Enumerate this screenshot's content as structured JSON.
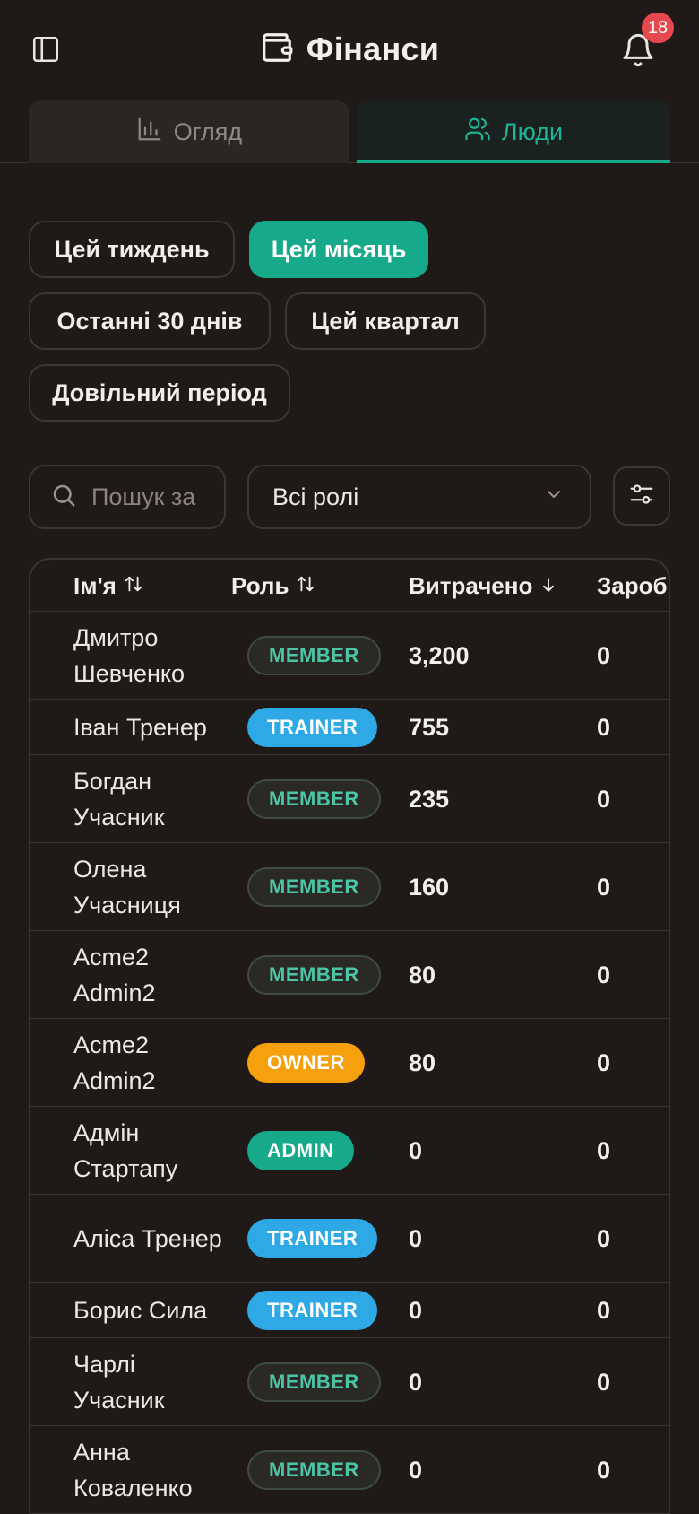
{
  "header": {
    "title": "Фінанси",
    "notification_count": "18",
    "wallet_icon": "wallet-icon",
    "bell_icon": "bell-icon"
  },
  "tabs": [
    {
      "label": "Огляд",
      "icon": "bar-chart-icon",
      "active": false
    },
    {
      "label": "Люди",
      "icon": "users-icon",
      "active": true
    }
  ],
  "periods": [
    {
      "label": "Цей тиждень",
      "active": false
    },
    {
      "label": "Цей місяць",
      "active": true
    },
    {
      "label": "Останні 30 днів",
      "active": false
    },
    {
      "label": "Цей квартал",
      "active": false
    },
    {
      "label": "Довільний період",
      "active": false
    }
  ],
  "search": {
    "placeholder": "Пошук за",
    "value": ""
  },
  "role_filter": {
    "selected": "Всі ролі"
  },
  "table": {
    "columns": [
      {
        "label": "Ім'я",
        "sort": "both"
      },
      {
        "label": "Роль",
        "sort": "both"
      },
      {
        "label": "Витрачено",
        "sort": "desc"
      },
      {
        "label": "Зароб",
        "sort": "none"
      }
    ],
    "rows": [
      {
        "name": "Дмитро Шевченко",
        "role": "MEMBER",
        "spent": "3,200",
        "earned": "0"
      },
      {
        "name": "Іван Тренер",
        "role": "TRAINER",
        "spent": "755",
        "earned": "0"
      },
      {
        "name": "Богдан Учасник",
        "role": "MEMBER",
        "spent": "235",
        "earned": "0"
      },
      {
        "name": "Олена Учасниця",
        "role": "MEMBER",
        "spent": "160",
        "earned": "0"
      },
      {
        "name": "Acme2 Admin2",
        "role": "MEMBER",
        "spent": "80",
        "earned": "0"
      },
      {
        "name": "Acme2 Admin2",
        "role": "OWNER",
        "spent": "80",
        "earned": "0"
      },
      {
        "name": "Адмін Стартапу",
        "role": "ADMIN",
        "spent": "0",
        "earned": "0"
      },
      {
        "name": "Аліса Тренер",
        "role": "TRAINER",
        "spent": "0",
        "earned": "0"
      },
      {
        "name": "Борис Сила",
        "role": "TRAINER",
        "spent": "0",
        "earned": "0"
      },
      {
        "name": "Чарлі Учасник",
        "role": "MEMBER",
        "spent": "0",
        "earned": "0"
      },
      {
        "name": "Анна Коваленко",
        "role": "MEMBER",
        "spent": "0",
        "earned": "0"
      }
    ]
  },
  "colors": {
    "background": "#1f1a17",
    "accent": "#16a98a",
    "trainer": "#2fa9e6",
    "owner": "#f5a00c",
    "badge": "#e5484d"
  }
}
